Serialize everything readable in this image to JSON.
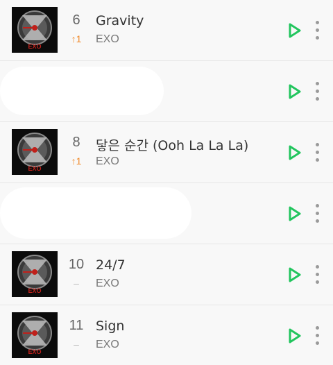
{
  "tracks": [
    {
      "rank": "6",
      "change": "↑1",
      "change_kind": "up",
      "title": "Gravity",
      "artist": "EXO",
      "play_icon": "play-icon",
      "more_icon": "more-vertical-icon"
    },
    {
      "rank": "",
      "change": "",
      "change_kind": "none",
      "title": "",
      "artist": "",
      "play_icon": "play-icon",
      "more_icon": "more-vertical-icon",
      "redacted": true
    },
    {
      "rank": "8",
      "change": "↑1",
      "change_kind": "up",
      "title": "닿은 순간 (Ooh La La La)",
      "artist": "EXO",
      "play_icon": "play-icon",
      "more_icon": "more-vertical-icon"
    },
    {
      "rank": "",
      "change": "",
      "change_kind": "none",
      "title": "",
      "artist": "",
      "play_icon": "play-icon",
      "more_icon": "more-vertical-icon",
      "redacted": true
    },
    {
      "rank": "10",
      "change": "–",
      "change_kind": "none",
      "title": "24/7",
      "artist": "EXO",
      "play_icon": "play-icon",
      "more_icon": "more-vertical-icon"
    },
    {
      "rank": "11",
      "change": "–",
      "change_kind": "none",
      "title": "Sign",
      "artist": "EXO",
      "play_icon": "play-icon",
      "more_icon": "more-vertical-icon"
    }
  ],
  "colors": {
    "accent_play": "#22c55e",
    "rank_up": "#f08a2a",
    "rank_same": "#b9b9b9",
    "background": "#f8f8f8"
  }
}
